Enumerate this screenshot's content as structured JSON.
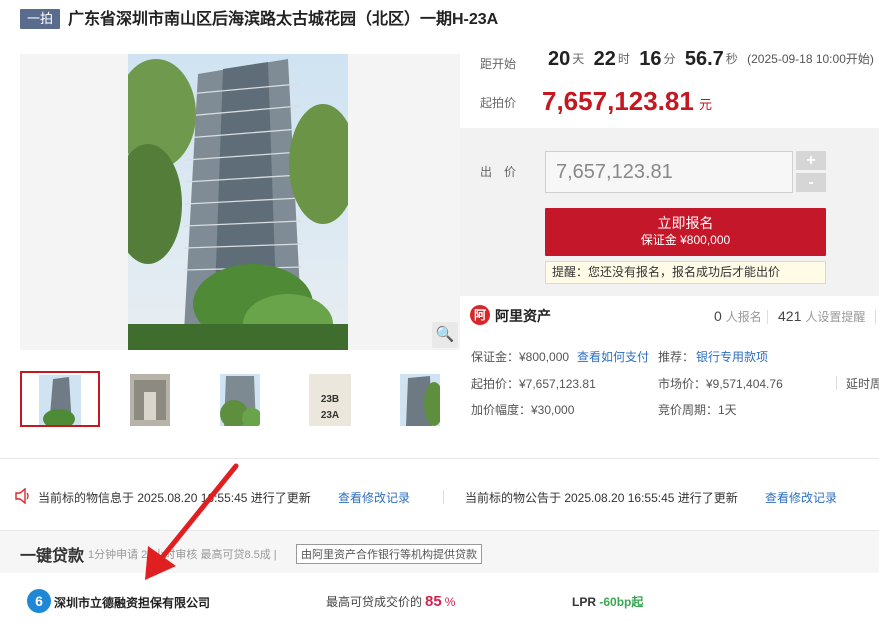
{
  "header": {
    "round_tag": "一拍",
    "title": "广东省深圳市南山区后海滨路太古城花园（北区）一期H-23A"
  },
  "auction": {
    "countdown_label": "距开始",
    "days": "20",
    "days_unit": "天",
    "hours": "22",
    "hours_unit": "时",
    "minutes": "16",
    "minutes_unit": "分",
    "seconds": "56.7",
    "seconds_unit": "秒",
    "start_time": "(2025-09-18 10:00开始)",
    "start_price_label": "起拍价",
    "start_price": "7,657,123.81",
    "currency_unit": "元"
  },
  "bid": {
    "label": "出　价",
    "value": "7,657,123.81",
    "plus": "+",
    "minus": "-",
    "register_label": "立即报名",
    "deposit_label": "保证金 ¥800,000",
    "tip": "提醒：您还没有报名，报名成功后才能出价"
  },
  "platform": {
    "logo_glyph": "阿",
    "name": "阿里资产",
    "registrants": "0",
    "registrants_label": "人报名",
    "reminders": "421",
    "reminders_label": "人设置提醒"
  },
  "details": {
    "deposit": "保证金：¥800,000",
    "how_to_pay": "查看如何支付",
    "recommend_label": "推荐：",
    "recommend_link": "银行专用款项",
    "start_price": "起拍价：¥7,657,123.81",
    "market_price": "市场价：¥9,571,404.76",
    "delay_cycle": "延时周",
    "increment": "加价幅度：¥30,000",
    "bid_cycle": "竞价周期：1天"
  },
  "updates": {
    "item_info": "当前标的物信息于 2025.08.20 16:55:45 进行了更新",
    "item_link": "查看修改记录",
    "notice_info": "当前标的物公告于 2025.08.20 16:55:45 进行了更新",
    "notice_link": "查看修改记录"
  },
  "loan": {
    "title": "一键贷款",
    "subtitle": "1分钟申请 24小时审核 最高可贷8.5成 |",
    "note": "由阿里资产合作银行等机构提供贷款",
    "lender_glyph": "6",
    "lender_name": "深圳市立德融资担保有限公司",
    "ratio_label": "最高可贷成交价的",
    "ratio_value": "85",
    "ratio_unit": "%",
    "lpr_label": "LPR",
    "lpr_value": "-60bp起"
  },
  "thumbs": {
    "sign1": "23B",
    "sign2": "23A"
  },
  "icons": {
    "zoom": "magnifier-icon",
    "speaker": "speaker-icon"
  },
  "colors": {
    "accent_red": "#c4171f",
    "link_blue": "#2f6fbf",
    "tag_bg": "#5a6c8e",
    "loan_pct": "#d6214f",
    "lpr_green": "#3ca655"
  }
}
